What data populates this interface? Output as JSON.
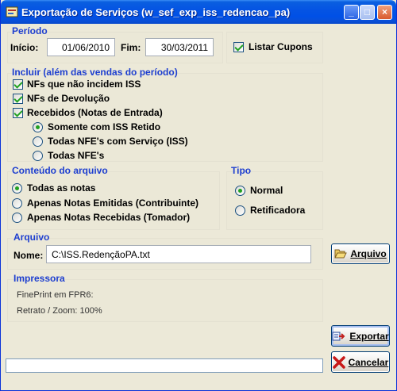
{
  "window": {
    "title": "Exportação de Serviços (w_sef_exp_iss_redencao_pa)"
  },
  "periodo": {
    "group_label": "Período",
    "inicio_label": "Início:",
    "inicio_value": "01/06/2010",
    "fim_label": "Fim:",
    "fim_value": "30/03/2011",
    "listar_cupons_label": "Listar Cupons"
  },
  "incluir": {
    "group_label": "Incluir (além das vendas do período)",
    "nfs_nao_incidem": "NFs que não incidem ISS",
    "nfs_devolucao": "NFs de Devolução",
    "recebidos": "Recebidos (Notas de Entrada)",
    "radios": [
      "Somente com ISS Retido",
      "Todas NFE's com Serviço (ISS)",
      "Todas NFE's"
    ],
    "selected": "Somente com ISS Retido"
  },
  "conteudo": {
    "group_label": "Conteúdo do arquivo",
    "options": [
      "Todas as notas",
      "Apenas Notas Emitidas (Contribuinte)",
      "Apenas Notas Recebidas (Tomador)"
    ],
    "selected": "Todas as notas"
  },
  "tipo": {
    "group_label": "Tipo",
    "options": [
      "Normal",
      "Retificadora"
    ],
    "selected": "Normal"
  },
  "arquivo": {
    "group_label": "Arquivo",
    "nome_label": "Nome:",
    "nome_value": "C:\\ISS.RedençãoPA.txt",
    "button_label": "Arquivo"
  },
  "impressora": {
    "group_label": "Impressora",
    "line1": "FinePrint em FPR6:",
    "line2": "Retrato / Zoom: 100%"
  },
  "actions": {
    "exportar_label": "Exportar",
    "cancelar_label": "Cancelar"
  },
  "progress": {
    "value": 0
  }
}
